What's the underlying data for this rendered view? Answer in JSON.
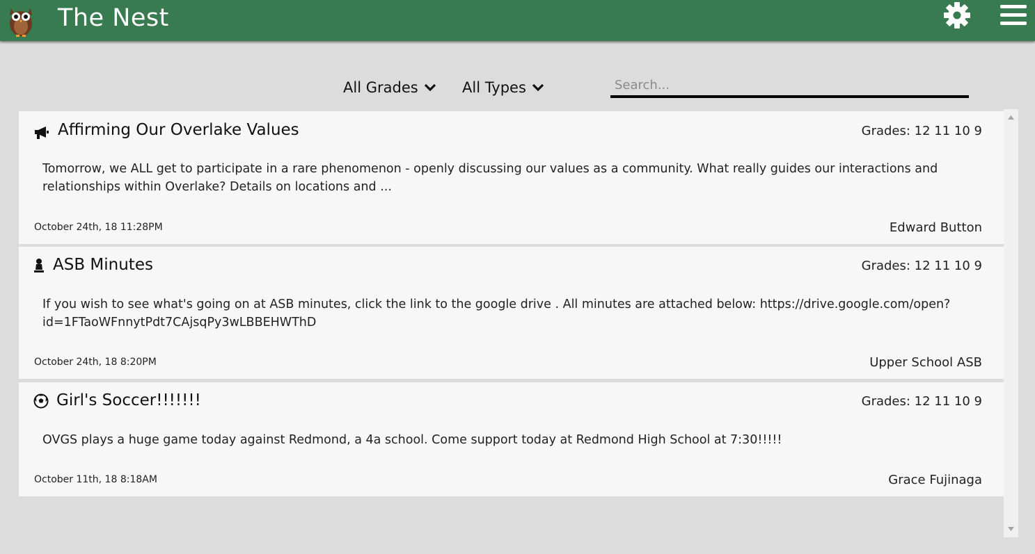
{
  "header": {
    "title": "The Nest",
    "logo_icon": "owl-icon",
    "settings_icon": "gear-icon",
    "menu_icon": "hamburger-menu-icon",
    "bg_color": "#387b50"
  },
  "filters": {
    "grades_label": "All Grades",
    "types_label": "All Types",
    "search_placeholder": "Search..."
  },
  "posts": [
    {
      "icon": "megaphone-icon",
      "title": "Affirming Our Overlake Values",
      "grades": "Grades: 12 11 10 9",
      "body": "Tomorrow, we ALL get to participate in a rare phenomenon - openly discussing our values as a community. What really guides our interactions and relationships within Overlake? Details on locations and ...",
      "date": "October 24th, 18 11:28PM",
      "author": "Edward Button"
    },
    {
      "icon": "chess-pawn-icon",
      "title": "ASB Minutes",
      "grades": "Grades: 12 11 10 9",
      "body": "If you wish to see what's going on at ASB minutes, click the link to the google drive . All minutes are attached below: https://drive.google.com/open?id=1FTaoWFnnytPdt7CAjsqPy3wLBBEHWThD",
      "date": "October 24th, 18 8:20PM",
      "author": "Upper School ASB"
    },
    {
      "icon": "soccer-ball-icon",
      "title": "Girl's Soccer!!!!!!!",
      "grades": "Grades: 12 11 10 9",
      "body": "OVGS plays a huge game today against Redmond, a 4a school. Come support today at Redmond High School at 7:30!!!!!",
      "date": "October 11th, 18 8:18AM",
      "author": "Grace Fujinaga"
    }
  ]
}
